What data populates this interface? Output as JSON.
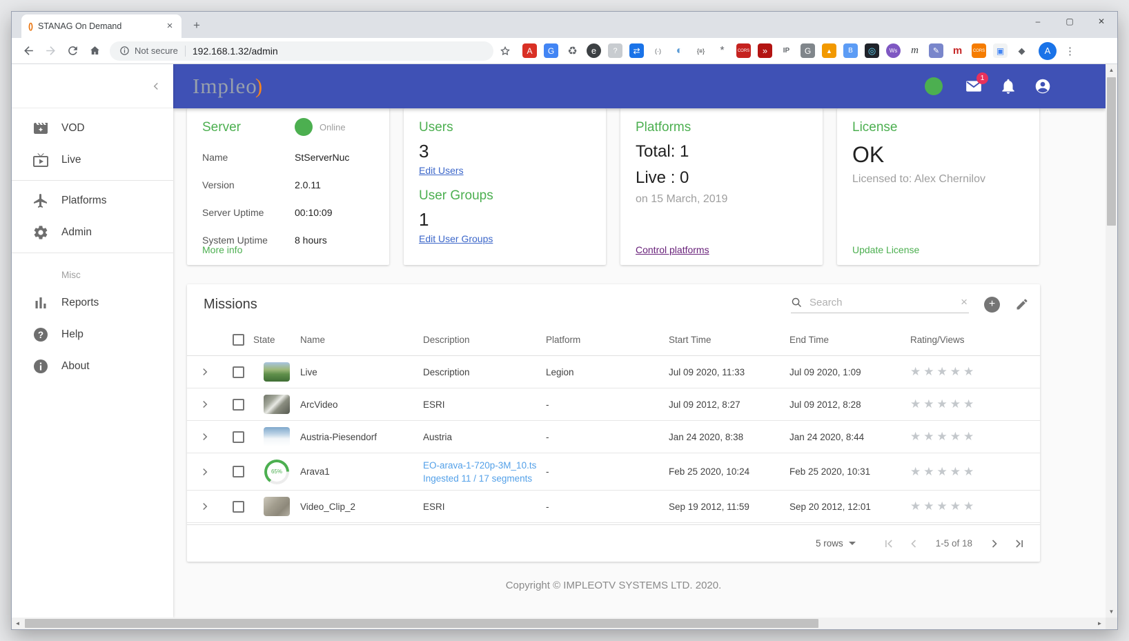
{
  "browser": {
    "tab_title": "STANAG On Demand",
    "new_tab_label": "+",
    "security_label": "Not secure",
    "url": "192.168.1.32/admin",
    "profile_initial": "A",
    "menu_glyph": "⋮",
    "window_controls": {
      "minimize": "–",
      "maximize": "▢",
      "close": "✕"
    },
    "extensions": [
      {
        "name": "dictionary-icon",
        "glyph": "A",
        "bg": "#d93025",
        "fg": "#ffffff",
        "shape": "sq",
        "fs": 12
      },
      {
        "name": "translate-icon",
        "glyph": "G",
        "bg": "#4285f4",
        "fg": "#ffffff",
        "shape": "sq",
        "fs": 12
      },
      {
        "name": "recycle-icon",
        "glyph": "♻",
        "bg": "none",
        "fg": "#5f6368",
        "shape": "sq",
        "fs": 16
      },
      {
        "name": "edge-e-icon",
        "glyph": "e",
        "bg": "#3c4043",
        "fg": "#ffffff",
        "shape": "rd",
        "fs": 13
      },
      {
        "name": "screen-capture-icon",
        "glyph": "?",
        "bg": "#c8ccd0",
        "fg": "#ffffff",
        "shape": "sq",
        "fs": 11
      },
      {
        "name": "tab-swap-icon",
        "glyph": "⇄",
        "bg": "#1a73e8",
        "fg": "#ffffff",
        "shape": "sq",
        "fs": 12
      },
      {
        "name": "paren-circle-icon",
        "glyph": "(·)",
        "bg": "none",
        "fg": "#5f6368",
        "shape": "rd",
        "fs": 9
      },
      {
        "name": "swirl-icon",
        "glyph": "◐",
        "bg": "none",
        "fg": "#5b9bd5",
        "shape": "rd",
        "fs": 16
      },
      {
        "name": "braces-icon",
        "glyph": "{≡}",
        "bg": "none",
        "fg": "#3c4043",
        "shape": "sq",
        "fs": 9
      },
      {
        "name": "spider-icon",
        "glyph": "*",
        "bg": "none",
        "fg": "#5f6368",
        "shape": "sq",
        "fs": 16
      },
      {
        "name": "cors-red-icon",
        "glyph": "CORS",
        "bg": "#c5221f",
        "fg": "#ffffff",
        "shape": "sq",
        "fs": 6
      },
      {
        "name": "fast-forward-icon",
        "glyph": "»",
        "bg": "#b31412",
        "fg": "#ffffff",
        "shape": "sq",
        "fs": 13
      },
      {
        "name": "ip-lookup-icon",
        "glyph": "IP",
        "bg": "none",
        "fg": "#5f6368",
        "shape": "sq",
        "fs": 10
      },
      {
        "name": "g-gray-icon",
        "glyph": "G",
        "bg": "#80868b",
        "fg": "#ffffff",
        "shape": "sq",
        "fs": 12
      },
      {
        "name": "analytics-icon",
        "glyph": "▲",
        "bg": "#f29900",
        "fg": "#ffffff",
        "shape": "sq",
        "fs": 9
      },
      {
        "name": "tag-icon",
        "glyph": "B",
        "bg": "#5c9cf5",
        "fg": "#ffffff",
        "shape": "sq",
        "fs": 10
      },
      {
        "name": "react-icon",
        "glyph": "◎",
        "bg": "#20232a",
        "fg": "#61dafb",
        "shape": "sq",
        "fs": 13
      },
      {
        "name": "ws-icon",
        "glyph": "Ws",
        "bg": "#7e57c2",
        "fg": "#ffffff",
        "shape": "rd",
        "fs": 8
      },
      {
        "name": "m-italic-icon",
        "glyph": "m",
        "bg": "none",
        "fg": "#3c4043",
        "shape": "sq",
        "fs": 15,
        "style": "italic"
      },
      {
        "name": "notes-icon",
        "glyph": "✎",
        "bg": "#7986cb",
        "fg": "#ffffff",
        "shape": "sq",
        "fs": 11
      },
      {
        "name": "m-red-icon",
        "glyph": "m",
        "bg": "none",
        "fg": "#c62828",
        "shape": "sq",
        "fs": 15,
        "style": "bold"
      },
      {
        "name": "cors-orange-icon",
        "glyph": "CORS",
        "bg": "#f57c00",
        "fg": "#ffffff",
        "shape": "sq",
        "fs": 6
      },
      {
        "name": "photos-icon",
        "glyph": "▣",
        "bg": "#f1f3f4",
        "fg": "#4285f4",
        "shape": "sq",
        "fs": 12
      },
      {
        "name": "puzzle-icon",
        "glyph": "◆",
        "bg": "none",
        "fg": "#5f6368",
        "shape": "sq",
        "fs": 13
      }
    ]
  },
  "header": {
    "logo": "Impleo",
    "logo_accent": ")",
    "mail_badge": "1"
  },
  "sidebar": {
    "sections": [
      {
        "label": null,
        "items": [
          {
            "label": "VOD",
            "icon": "movie"
          },
          {
            "label": "Live",
            "icon": "live-tv"
          }
        ]
      },
      {
        "label": null,
        "items": [
          {
            "label": "Platforms",
            "icon": "airplane"
          },
          {
            "label": "Admin",
            "icon": "gear"
          }
        ]
      },
      {
        "label": "Misc",
        "items": [
          {
            "label": "Reports",
            "icon": "bar-chart"
          },
          {
            "label": "Help",
            "icon": "help"
          },
          {
            "label": "About",
            "icon": "info"
          }
        ]
      }
    ]
  },
  "cards": {
    "server": {
      "title": "Server",
      "status_label": "Online",
      "rows": [
        [
          "Name",
          "StServerNuc"
        ],
        [
          "Version",
          "2.0.11"
        ],
        [
          "Server Uptime",
          "00:10:09"
        ],
        [
          "System Uptime",
          "8 hours"
        ]
      ],
      "link": "More info"
    },
    "users": {
      "title": "Users",
      "count": "3",
      "edit_link": "Edit Users",
      "groups_title": "User Groups",
      "groups_count": "1",
      "groups_link": "Edit User Groups"
    },
    "platforms": {
      "title": "Platforms",
      "total": "Total: 1",
      "live": "Live : 0",
      "date": "on 15 March, 2019",
      "link": "Control platforms"
    },
    "license": {
      "title": "License",
      "status": "OK",
      "licensed_to": "Licensed to: Alex Chernilov",
      "link": "Update License"
    }
  },
  "missions": {
    "title": "Missions",
    "search_placeholder": "Search",
    "columns": [
      "State",
      "Name",
      "Description",
      "Platform",
      "Start Time",
      "End Time",
      "Rating/Views"
    ],
    "rows": [
      {
        "name": "Live",
        "desc": "Description",
        "desc2": "",
        "desc_style": "normal",
        "platform": "Legion",
        "start": "Jul 09 2020, 11:33",
        "end": "Jul 09 2020, 1:09",
        "state": "thumb",
        "thumb": "aerial-green",
        "rating": 0,
        "rating_max": 5
      },
      {
        "name": "ArcVideo",
        "desc": "ESRI",
        "desc2": "",
        "desc_style": "normal",
        "platform": "-",
        "start": "Jul 09 2012, 8:27",
        "end": "Jul 09 2012, 8:28",
        "state": "thumb",
        "thumb": "aerial-industrial",
        "rating": 0,
        "rating_max": 5
      },
      {
        "name": "Austria-Piesendorf",
        "desc": "Austria",
        "desc2": "",
        "desc_style": "normal",
        "platform": "-",
        "start": "Jan 24 2020, 8:38",
        "end": "Jan 24 2020, 8:44",
        "state": "thumb",
        "thumb": "snow-mountain",
        "rating": 0,
        "rating_max": 5
      },
      {
        "name": "Arava1",
        "desc": "EO-arava-1-720p-3M_10.ts",
        "desc2": "Ingested 11 / 17 segments",
        "desc_style": "ingesting",
        "platform": "-",
        "start": "Feb 25 2020, 10:24",
        "end": "Feb 25 2020, 10:31",
        "state": "progress",
        "progress": "65%",
        "rating": 0,
        "rating_max": 5
      },
      {
        "name": "Video_Clip_2",
        "desc": "ESRI",
        "desc2": "",
        "desc_style": "normal",
        "platform": "-",
        "start": "Sep 19 2012, 11:59",
        "end": "Sep 20 2012, 12:01",
        "state": "thumb",
        "thumb": "terrain-gray",
        "rating": 0,
        "rating_max": 5
      }
    ],
    "pagination": {
      "rows_per_page": "5 rows",
      "range": "1-5 of 18"
    }
  },
  "footer": {
    "copyright": "Copyright © IMPLEOTV SYSTEMS LTD. 2020."
  },
  "colors": {
    "accent": "#3f51b5",
    "green": "#4caf50",
    "badge": "#e8315b",
    "link_blue": "#3b66c9",
    "link_purple": "#682079",
    "ingest_blue": "#53a0e8"
  }
}
